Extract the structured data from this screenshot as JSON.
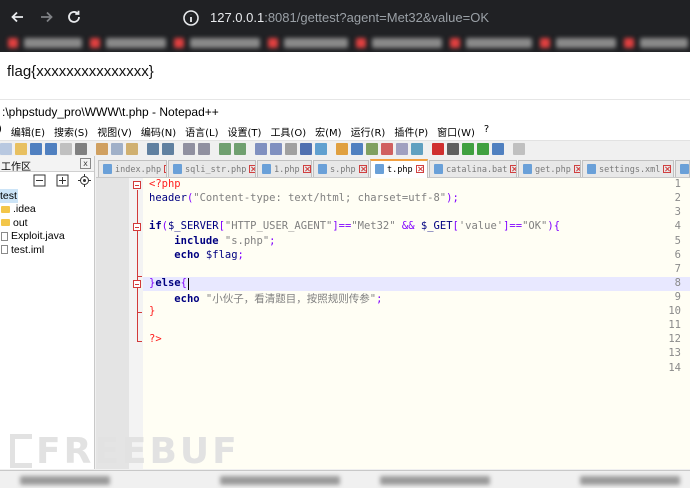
{
  "browser": {
    "url_host": "127.0.0.1",
    "url_rest": ":8081/gettest?agent=Met32&value=OK",
    "nav_icons": [
      "back-icon",
      "forward-icon",
      "reload-icon",
      "site-info-icon"
    ]
  },
  "page": {
    "flag_text": "flag{xxxxxxxxxxxxxxx}"
  },
  "npp": {
    "title": ":\\phpstudy_pro\\WWW\\t.php - Notepad++",
    "menu": [
      ")",
      "编辑(E)",
      "搜索(S)",
      "视图(V)",
      "编码(N)",
      "语言(L)",
      "设置(T)",
      "工具(O)",
      "宏(M)",
      "运行(R)",
      "插件(P)",
      "窗口(W)",
      "?"
    ],
    "panel_title": "工作区",
    "panel_close": "x",
    "tree": [
      {
        "label": "test",
        "kind": "root"
      },
      {
        "label": ".idea",
        "kind": "folder"
      },
      {
        "label": "out",
        "kind": "folder"
      },
      {
        "label": "Exploit.java",
        "kind": "file"
      },
      {
        "label": "test.iml",
        "kind": "file"
      }
    ],
    "tabs": [
      {
        "label": "index.php",
        "active": false
      },
      {
        "label": "sqli_str.php",
        "active": false
      },
      {
        "label": "1.php",
        "active": false
      },
      {
        "label": "s.php",
        "active": false
      },
      {
        "label": "t.php",
        "active": true
      },
      {
        "label": "catalina.bat",
        "active": false
      },
      {
        "label": "get.php",
        "active": false
      },
      {
        "label": "settings.xml",
        "active": false
      }
    ],
    "line_numbers": [
      "1",
      "2",
      "3",
      "4",
      "5",
      "6",
      "7",
      "8",
      "9",
      "10",
      "11",
      "12",
      "13",
      "14"
    ],
    "code": {
      "l1": "<?php",
      "l2_fn": "header",
      "l2_str": "\"Content-type: text/html; charset=utf-8\"",
      "l4_kw": "if",
      "l4_var1": "$_SERVER",
      "l4_str1": "\"HTTP_USER_AGENT\"",
      "l4_str2": "\"Met32\"",
      "l4_var2": "$_GET",
      "l4_str3": "'value'",
      "l4_str4": "\"OK\"",
      "l5_kw": "include",
      "l5_str": "\"s.php\"",
      "l6_kw": "echo",
      "l6_var": "$flag",
      "l8_kw": "else",
      "l9_kw": "echo",
      "l9_str": "\"小伙子，看清题目，按照规则传参\"",
      "l13": "?>"
    }
  },
  "watermark": "FREEBUF",
  "colors": {
    "browser_bg": "#202124",
    "editor_bg": "#fffef4",
    "php_tag": "#ff2020",
    "keyword": "#000080",
    "string": "#808080",
    "operator": "#8000ff"
  }
}
